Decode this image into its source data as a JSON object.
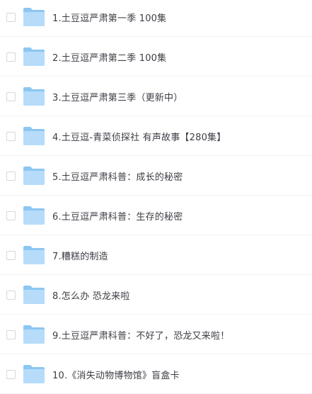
{
  "file_list": {
    "items": [
      {
        "name": "1.土豆逗严肃第一季 100集",
        "icon": "folder-icon",
        "checked": false
      },
      {
        "name": "2.土豆逗严肃第二季 100集",
        "icon": "folder-icon",
        "checked": false
      },
      {
        "name": "3.土豆逗严肃第三季（更新中）",
        "icon": "folder-icon",
        "checked": false
      },
      {
        "name": "4.土豆逗-青菜侦探社 有声故事【280集】",
        "icon": "folder-icon",
        "checked": false
      },
      {
        "name": "5.土豆逗严肃科普：成长的秘密",
        "icon": "folder-icon",
        "checked": false
      },
      {
        "name": "6.土豆逗严肃科普：生存的秘密",
        "icon": "folder-icon",
        "checked": false
      },
      {
        "name": "7.糟糕的制造",
        "icon": "folder-icon",
        "checked": false
      },
      {
        "name": "8.怎么办 恐龙来啦",
        "icon": "folder-icon",
        "checked": false
      },
      {
        "name": "9.土豆逗严肃科普：不好了，恐龙又来啦！",
        "icon": "folder-icon",
        "checked": false
      },
      {
        "name": "10.《消失动物博物馆》盲盒卡",
        "icon": "folder-icon",
        "checked": false
      }
    ]
  },
  "colors": {
    "folder_back": "#8cc6f2",
    "folder_front": "#b6dcfa",
    "text": "#3b3e44",
    "checkbox_border": "#d4d7dc",
    "divider": "#f1f2f4"
  }
}
